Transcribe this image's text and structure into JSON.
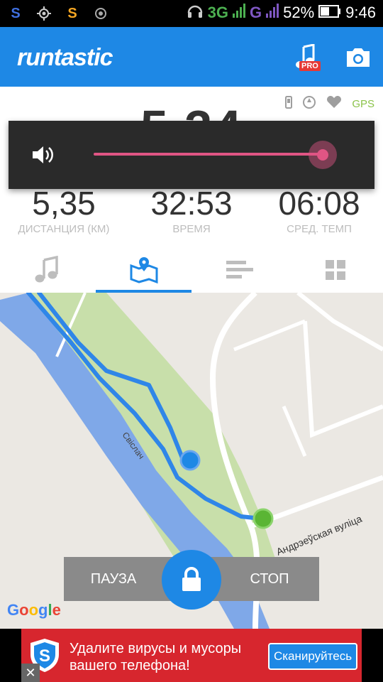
{
  "status_bar": {
    "network": "3G",
    "network2": "G",
    "battery": "52%",
    "time": "9:46"
  },
  "app_bar": {
    "logo": "runtastic",
    "pro_badge": "PRO"
  },
  "sensors": {
    "gps_label": "GPS"
  },
  "main_value": "5,34",
  "metrics": [
    {
      "value": "5,35",
      "label": "ДИСТАНЦИЯ (КМ)"
    },
    {
      "value": "32:53",
      "label": "ВРЕМЯ"
    },
    {
      "value": "06:08",
      "label": "СРЕД. ТЕМП"
    }
  ],
  "volume": {
    "level": 0.99,
    "accent": "#e05584"
  },
  "tabs": [
    "music",
    "map",
    "stats",
    "dashboard"
  ],
  "map": {
    "river_label": "Свiслач",
    "street_label": "Андрэеўская вуліца",
    "attribution": "Google"
  },
  "controls": {
    "pause": "ПАУЗА",
    "stop": "СТОП"
  },
  "ad": {
    "line1": "Удалите вирусы и мусоры",
    "line2": "вашего телефона!",
    "button": "Сканируйтесь",
    "close": "✕"
  },
  "colors": {
    "brand": "#1e88e5",
    "route": "#2f86e8",
    "start_marker": "#5ab534",
    "current_marker": "#1e88e5"
  }
}
